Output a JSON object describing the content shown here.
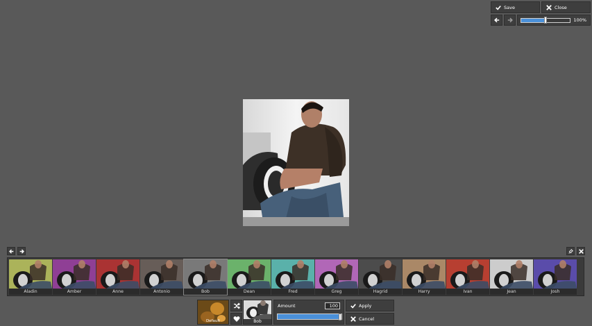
{
  "toolbar": {
    "save_label": "Save",
    "close_label": "Close",
    "zoom_label": "100%",
    "zoom_level": 0.5
  },
  "filters": [
    {
      "name": "Aladin",
      "tint": "#c9d36a"
    },
    {
      "name": "Amber",
      "tint": "#a84ab0"
    },
    {
      "name": "Anne",
      "tint": "#c83c3c"
    },
    {
      "name": "Antonio",
      "tint": "#7a6e68"
    },
    {
      "name": "Bob",
      "tint": "#8f8f8f"
    },
    {
      "name": "Dean",
      "tint": "#7ed27e"
    },
    {
      "name": "Fred",
      "tint": "#6ad0c8"
    },
    {
      "name": "Greg",
      "tint": "#d07ad8"
    },
    {
      "name": "Hagrid",
      "tint": "#5a5a5a"
    },
    {
      "name": "Harry",
      "tint": "#c8a07a"
    },
    {
      "name": "Ivan",
      "tint": "#d84a3a"
    },
    {
      "name": "Jean",
      "tint": "#f0f0f0"
    },
    {
      "name": "Josh",
      "tint": "#6a5ac8"
    }
  ],
  "panel": {
    "default_label": "Default",
    "current_label": "Bob",
    "amount_label": "Amount",
    "amount_value": "100",
    "amount_level": 1.0,
    "apply_label": "Apply",
    "cancel_label": "Cancel"
  },
  "colors": {
    "background": "#595959",
    "accent": "#4a90d9"
  }
}
